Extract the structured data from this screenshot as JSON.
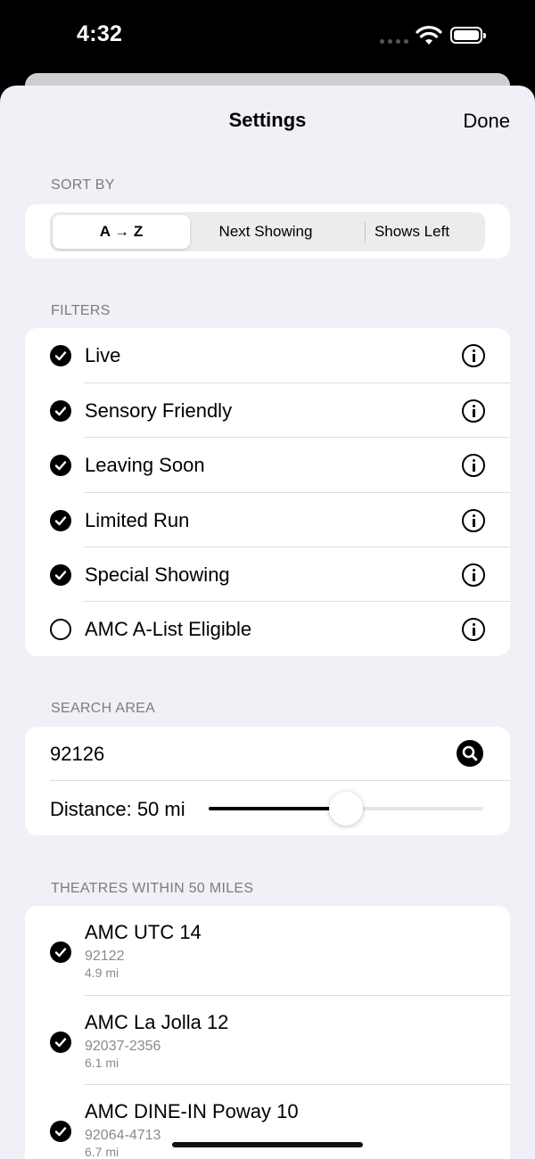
{
  "status": {
    "time": "4:32"
  },
  "header": {
    "title": "Settings",
    "done_label": "Done"
  },
  "sort": {
    "label": "SORT BY",
    "options": [
      "A → Z",
      "Next Showing",
      "Shows Left"
    ],
    "selected": "A → Z"
  },
  "filters": {
    "label": "FILTERS",
    "items": [
      {
        "label": "Live",
        "checked": true
      },
      {
        "label": "Sensory Friendly",
        "checked": true
      },
      {
        "label": "Leaving Soon",
        "checked": true
      },
      {
        "label": "Limited Run",
        "checked": true
      },
      {
        "label": "Special Showing",
        "checked": true
      },
      {
        "label": "AMC A-List Eligible",
        "checked": false
      }
    ]
  },
  "search_area": {
    "label": "SEARCH AREA",
    "zip": "92126",
    "distance_label": "Distance: 50 mi",
    "slider_fraction": 0.5
  },
  "theatres": {
    "label": "THEATRES WITHIN 50 MILES",
    "items": [
      {
        "name": "AMC UTC 14",
        "zip": "92122",
        "distance": "4.9 mi",
        "checked": true
      },
      {
        "name": "AMC La Jolla 12",
        "zip": "92037-2356",
        "distance": "6.1 mi",
        "checked": true
      },
      {
        "name": "AMC DINE-IN Poway 10",
        "zip": "92064-4713",
        "distance": "6.7 mi",
        "checked": true
      }
    ]
  },
  "colors": {
    "sheet_bg": "#f1f0f6",
    "card_bg": "#ffffff",
    "secondary_text": "#8a8a8e",
    "accent": "#000000"
  }
}
